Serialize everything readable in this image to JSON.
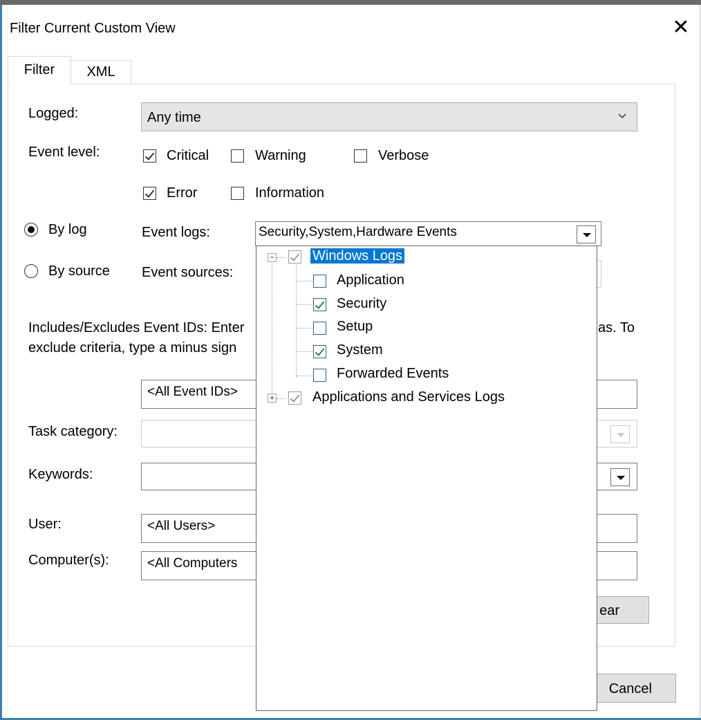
{
  "dialog": {
    "title": "Filter Current Custom View",
    "close_glyph": "✕"
  },
  "tabs": [
    {
      "label": "Filter",
      "active": true
    },
    {
      "label": "XML",
      "active": false
    }
  ],
  "filter": {
    "logged_label": "Logged:",
    "logged_value": "Any time",
    "event_level_label": "Event level:",
    "levels": {
      "critical": {
        "label": "Critical",
        "checked": true
      },
      "warning": {
        "label": "Warning",
        "checked": false
      },
      "verbose": {
        "label": "Verbose",
        "checked": false
      },
      "error": {
        "label": "Error",
        "checked": true
      },
      "information": {
        "label": "Information",
        "checked": false
      }
    },
    "by_log_label": "By log",
    "by_source_label": "By source",
    "event_logs_label": "Event logs:",
    "event_logs_value": "Security,System,Hardware Events",
    "event_sources_label": "Event sources:",
    "event_ids_text_line1": "Includes/Excludes Event IDs: Enter",
    "event_ids_text_line1_tail": "as. To",
    "event_ids_text_line2": "exclude criteria, type a minus sign",
    "event_ids_value": "<All Event IDs>",
    "task_category_label": "Task category:",
    "keywords_label": "Keywords:",
    "user_label": "User:",
    "user_value": "<All Users>",
    "computers_label": "Computer(s):",
    "computers_value": "<All Computers",
    "clear_button_label": "ear"
  },
  "footer": {
    "cancel_label": "Cancel"
  },
  "tree": {
    "windows_logs": {
      "label": "Windows Logs",
      "expander": "−",
      "checked": true,
      "selected": true
    },
    "children": [
      {
        "label": "Application",
        "checked": false
      },
      {
        "label": "Security",
        "checked": true
      },
      {
        "label": "Setup",
        "checked": false
      },
      {
        "label": "System",
        "checked": true
      },
      {
        "label": "Forwarded Events",
        "checked": false
      }
    ],
    "apps_services": {
      "label": "Applications and Services Logs",
      "expander": "+",
      "checked": true
    }
  },
  "colors": {
    "selection": "#0078d7",
    "check_green": "#2a8b2a",
    "window_accent": "#3c7fb1"
  }
}
